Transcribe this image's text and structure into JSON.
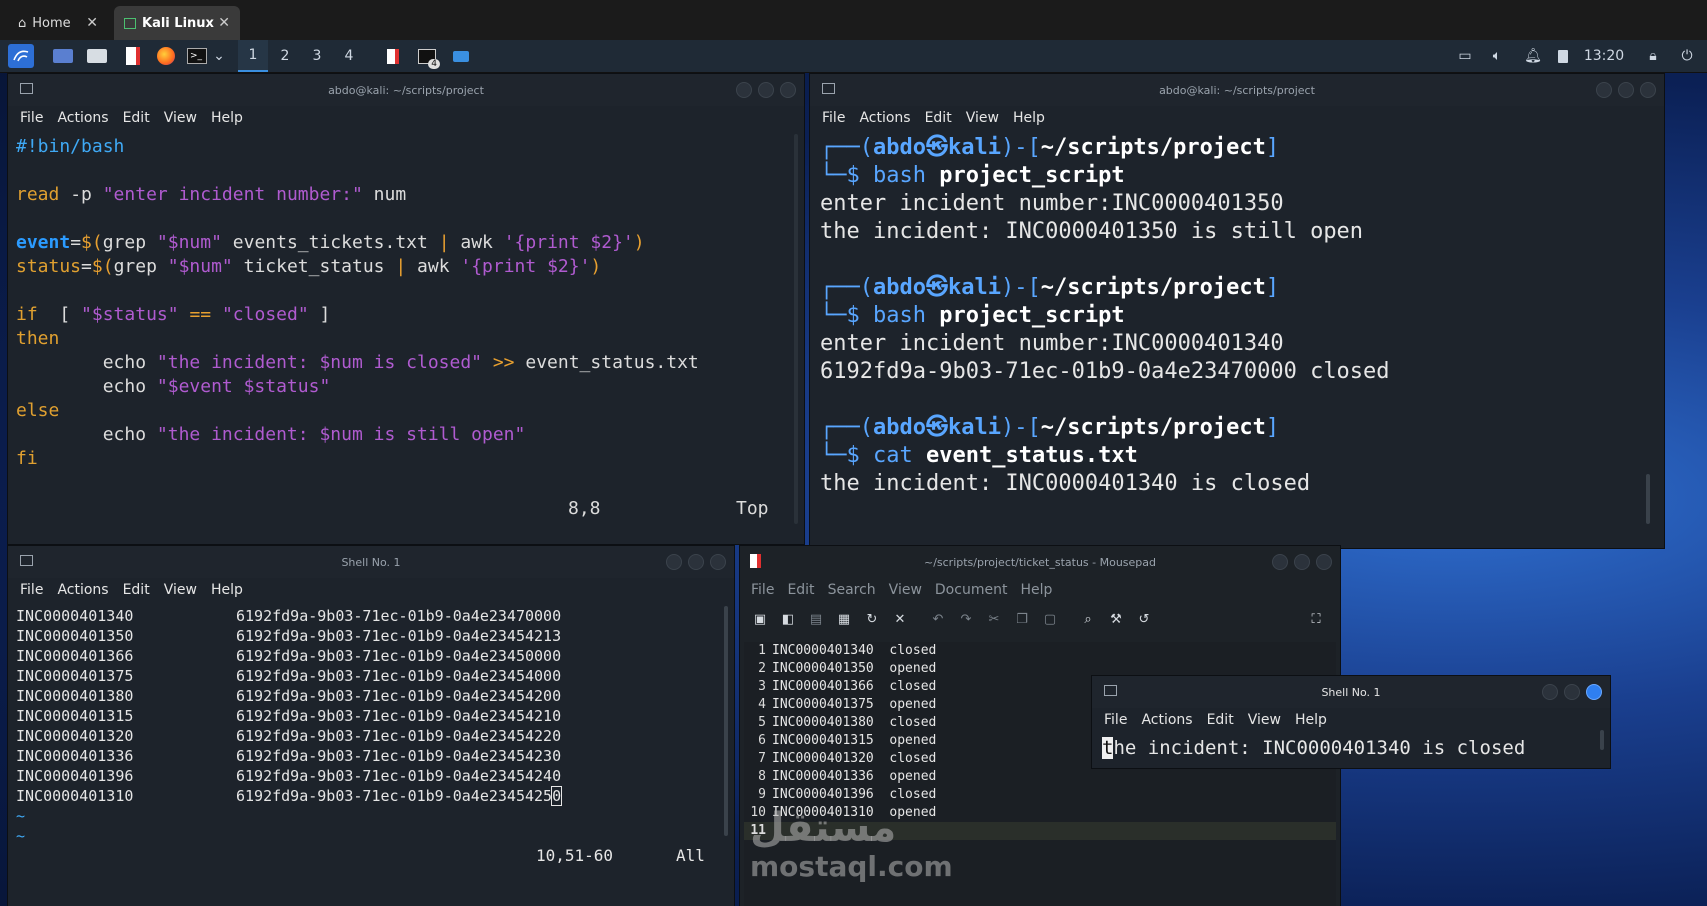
{
  "browser_tabs": [
    {
      "label": "Home",
      "icon": "home-icon"
    },
    {
      "label": "Kali Linux",
      "icon": "vm-icon"
    }
  ],
  "panel": {
    "workspaces": [
      "1",
      "2",
      "3",
      "4"
    ],
    "taskbar_badge": "4",
    "clock": "13:20"
  },
  "vim_window": {
    "title": "abdo@kali: ~/scripts/project",
    "menu": [
      "File",
      "Actions",
      "Edit",
      "View",
      "Help"
    ],
    "lines": [
      "#!bin/bash",
      "",
      "read -p \"enter incident number:\" num",
      "",
      "event=$(grep \"$num\" events_tickets.txt | awk '{print $2}')",
      "status=$(grep \"$num\" ticket_status | awk '{print $2}')",
      "",
      "if  [ \"$status\" == \"closed\" ]",
      "then",
      "        echo \"the incident: $num is closed\" >> event_status.txt",
      "        echo \"$event $status\"",
      "else",
      "        echo \"the incident: $num is still open\"",
      "fi"
    ],
    "ruler_pos": "8,8",
    "ruler_scroll": "Top"
  },
  "term_window": {
    "title": "abdo@kali: ~/scripts/project",
    "menu": [
      "File",
      "Actions",
      "Edit",
      "View",
      "Help"
    ],
    "prompt_user": "abdo",
    "prompt_host": "kali",
    "prompt_path": "~/scripts/project",
    "sessions": [
      {
        "cmd": "bash",
        "arg": "project_script",
        "output": [
          "enter incident number:INC0000401350",
          "the incident: INC0000401350 is still open"
        ]
      },
      {
        "cmd": "bash",
        "arg": "project_script",
        "output": [
          "enter incident number:INC0000401340",
          "6192fd9a-9b03-71ec-01b9-0a4e23470000 closed"
        ]
      },
      {
        "cmd": "cat",
        "arg": "event_status.txt",
        "output": [
          "the incident: INC0000401340 is closed"
        ]
      }
    ]
  },
  "shell1_window": {
    "title": "Shell No. 1",
    "menu": [
      "File",
      "Actions",
      "Edit",
      "View",
      "Help"
    ],
    "rows": [
      {
        "id": "INC0000401340",
        "guid": "6192fd9a-9b03-71ec-01b9-0a4e23470000"
      },
      {
        "id": "INC0000401350",
        "guid": "6192fd9a-9b03-71ec-01b9-0a4e23454213"
      },
      {
        "id": "INC0000401366",
        "guid": "6192fd9a-9b03-71ec-01b9-0a4e23450000"
      },
      {
        "id": "INC0000401375",
        "guid": "6192fd9a-9b03-71ec-01b9-0a4e23454000"
      },
      {
        "id": "INC0000401380",
        "guid": "6192fd9a-9b03-71ec-01b9-0a4e23454200"
      },
      {
        "id": "INC0000401315",
        "guid": "6192fd9a-9b03-71ec-01b9-0a4e23454210"
      },
      {
        "id": "INC0000401320",
        "guid": "6192fd9a-9b03-71ec-01b9-0a4e23454220"
      },
      {
        "id": "INC0000401336",
        "guid": "6192fd9a-9b03-71ec-01b9-0a4e23454230"
      },
      {
        "id": "INC0000401396",
        "guid": "6192fd9a-9b03-71ec-01b9-0a4e23454240"
      },
      {
        "id": "INC0000401310",
        "guid": "6192fd9a-9b03-71ec-01b9-0a4e23454250"
      }
    ],
    "tildes": [
      "~",
      "~"
    ],
    "ruler_pos": "10,51-60",
    "ruler_scroll": "All"
  },
  "mousepad_window": {
    "title": "~/scripts/project/ticket_status - Mousepad",
    "menu": [
      "File",
      "Edit",
      "Search",
      "View",
      "Document",
      "Help"
    ],
    "toolbar": [
      "new-file-icon",
      "new-window-icon",
      "save-icon",
      "save-all-icon",
      "reload-icon",
      "close-doc-icon",
      "undo-icon",
      "redo-icon",
      "cut-icon",
      "copy-icon",
      "paste-icon",
      "find-icon",
      "find-replace-icon",
      "goto-icon",
      "fullscreen-icon"
    ],
    "lines": [
      {
        "n": "1",
        "text": "INC0000401340  closed"
      },
      {
        "n": "2",
        "text": "INC0000401350  opened"
      },
      {
        "n": "3",
        "text": "INC0000401366  closed"
      },
      {
        "n": "4",
        "text": "INC0000401375  opened"
      },
      {
        "n": "5",
        "text": "INC0000401380  closed"
      },
      {
        "n": "6",
        "text": "INC0000401315  opened"
      },
      {
        "n": "7",
        "text": "INC0000401320  closed"
      },
      {
        "n": "8",
        "text": "INC0000401336  opened"
      },
      {
        "n": "9",
        "text": "INC0000401396  closed"
      },
      {
        "n": "10",
        "text": "INC0000401310  opened"
      },
      {
        "n": "11",
        "text": ""
      }
    ]
  },
  "shell_small": {
    "title": "Shell No. 1",
    "menu": [
      "File",
      "Actions",
      "Edit",
      "View",
      "Help"
    ],
    "cursor_char": "t",
    "line_rest": "he incident: INC0000401340 is closed"
  },
  "watermark": {
    "logo": "مستقل",
    "site": "mostaql.com"
  }
}
